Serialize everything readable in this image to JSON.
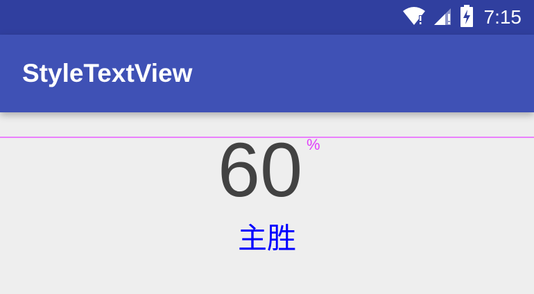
{
  "status_bar": {
    "time": "7:15",
    "icons": [
      "wifi-icon",
      "cell-signal-icon",
      "battery-charging-icon"
    ],
    "color": "#303f9f"
  },
  "app_bar": {
    "title": "StyleTextView",
    "color": "#3f51b5"
  },
  "content": {
    "value": "60",
    "unit": "%",
    "label": "主胜",
    "colors": {
      "value": "#424242",
      "unit": "#e040fb",
      "label": "#0000ff",
      "guide_line": "#ea80fc",
      "background": "#eeeeee"
    }
  }
}
